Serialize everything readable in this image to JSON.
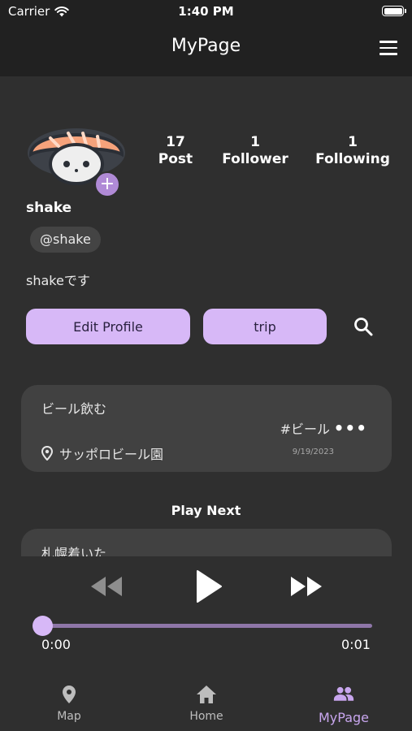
{
  "status_bar": {
    "carrier": "Carrier",
    "time": "1:40 PM"
  },
  "header": {
    "title": "MyPage"
  },
  "profile": {
    "display_name": "shake",
    "handle": "@shake",
    "bio": "shakeです",
    "stats": [
      {
        "count": "17",
        "label": "Post"
      },
      {
        "count": "1",
        "label": "Follower"
      },
      {
        "count": "1",
        "label": "Following"
      }
    ],
    "edit_label": "Edit Profile",
    "trip_label": "trip"
  },
  "post": {
    "title": "ビール飲む",
    "tag": "#ビール",
    "location": "サッポロビール園",
    "date": "9/19/2023",
    "more": "•••"
  },
  "play_next": {
    "heading": "Play Next",
    "next_title": "札幌着いた"
  },
  "player": {
    "current_time": "0:00",
    "end_time": "0:01",
    "progress": 0.0
  },
  "bottom_nav": [
    {
      "label": "Map",
      "icon": "map-pin-icon",
      "active": false
    },
    {
      "label": "Home",
      "icon": "home-icon",
      "active": false
    },
    {
      "label": "MyPage",
      "icon": "people-icon",
      "active": true
    }
  ],
  "colors": {
    "accent": "#d7b8f7",
    "active_tab": "#c8a6ee",
    "background": "#2f2f2f",
    "card": "#414141"
  }
}
